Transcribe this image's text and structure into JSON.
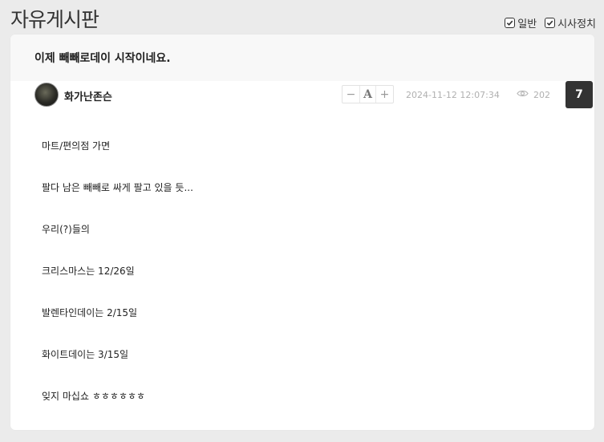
{
  "board": {
    "title": "자유게시판"
  },
  "filters": [
    {
      "label": "일반",
      "checked": true
    },
    {
      "label": "시사정치",
      "checked": true
    }
  ],
  "post": {
    "title": "이제 빼빼로데이 시작이네요.",
    "author": "화가난존슨",
    "font_controls": {
      "decrease": "−",
      "font": "A",
      "increase": "+"
    },
    "date": "2024-11-12 12:07:34",
    "views": "202",
    "comment_count": "7",
    "lines": [
      "마트/편의점 가면",
      "팔다 남은 빼빼로 싸게 팔고 있을 듯...",
      "우리(?)들의",
      "크리스마스는 12/26일",
      "발렌타인데이는 2/15일",
      "화이트데이는 3/15일",
      "잊지 마십쇼 ㅎㅎㅎㅎㅎㅎ"
    ]
  }
}
